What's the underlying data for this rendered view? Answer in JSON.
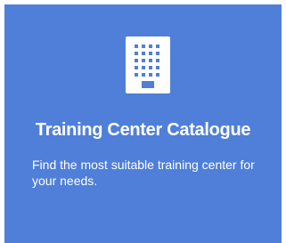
{
  "card": {
    "icon": "building-icon",
    "title": "Training Center Catalogue",
    "description": "Find the most suitable training center for your needs."
  },
  "colors": {
    "card_background": "#4f7fd8",
    "text": "#ffffff",
    "icon": "#ffffff"
  }
}
